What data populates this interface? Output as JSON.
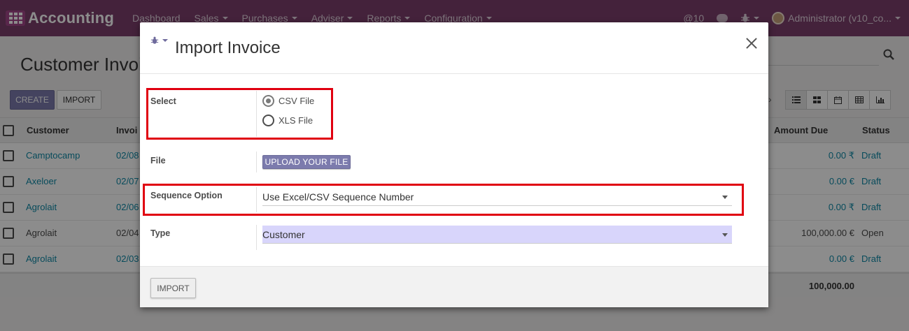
{
  "navbar": {
    "brand": "Accounting",
    "menu": [
      "Dashboard",
      "Sales",
      "Purchases",
      "Adviser",
      "Reports",
      "Configuration"
    ],
    "mentions": "@10",
    "user": "Administrator (v10_co..."
  },
  "page": {
    "title": "Customer Invoi",
    "create_label": "CREATE",
    "import_label": "IMPORT",
    "pager_next": "›"
  },
  "grid": {
    "headers": {
      "customer": "Customer",
      "invoice": "Invoi",
      "amount_due": "Amount Due",
      "status": "Status"
    },
    "rows": [
      {
        "customer": "Camptocamp",
        "date": "02/08",
        "amount": "0.00 ₹",
        "status": "Draft"
      },
      {
        "customer": "Axeloer",
        "date": "02/07",
        "amount": "0.00 €",
        "status": "Draft"
      },
      {
        "customer": "Agrolait",
        "date": "02/06",
        "amount": "0.00 ₹",
        "status": "Draft"
      },
      {
        "customer": "Agrolait",
        "date": "02/04",
        "amount": "100,000.00 €",
        "status": "Open"
      },
      {
        "customer": "Agrolait",
        "date": "02/03",
        "amount": "0.00 €",
        "status": "Draft"
      }
    ],
    "total": "100,000.00"
  },
  "modal": {
    "title": "Import Invoice",
    "select_label": "Select",
    "options": [
      "CSV File",
      "XLS File"
    ],
    "selected_option": "CSV File",
    "file_label": "File",
    "upload_label": "UPLOAD YOUR FILE",
    "sequence_label": "Sequence Option",
    "sequence_value": "Use Excel/CSV Sequence Number",
    "type_label": "Type",
    "type_value": "Customer",
    "import_button": "IMPORT"
  },
  "colors": {
    "navbar": "#7c3f6c",
    "primary_button": "#7c7bad",
    "link": "#0e89a7",
    "highlight": "#e00010",
    "required_field": "#d8d5fb"
  }
}
